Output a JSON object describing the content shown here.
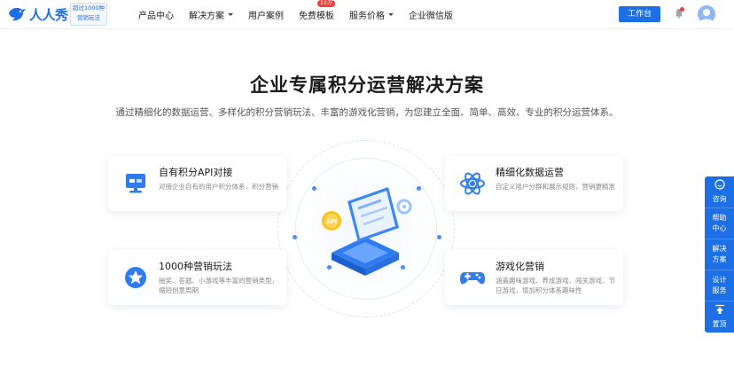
{
  "header": {
    "logo_text": "人人秀",
    "badge_line1": "超过1000种",
    "badge_line2": "营销玩法",
    "nav": [
      {
        "label": "产品中心",
        "dropdown": false
      },
      {
        "label": "解决方案",
        "dropdown": true
      },
      {
        "label": "用户案例",
        "dropdown": false
      },
      {
        "label": "免费模板",
        "dropdown": false,
        "badge": "10万"
      },
      {
        "label": "服务价格",
        "dropdown": true
      },
      {
        "label": "企业微信版",
        "dropdown": false
      }
    ],
    "workbench_label": "工作台",
    "icons": {
      "bell": "bell-icon",
      "avatar": "avatar-icon"
    }
  },
  "hero": {
    "title": "企业专属积分运营解决方案",
    "subtitle": "通过精细化的数据运营、多样化的积分营销玩法、丰富的游戏化营销，为您建立全面、简单、高效、专业的积分运营体系。"
  },
  "cards": [
    {
      "title": "自有积分API对接",
      "desc": "对接企业自有的用户积分体系，积分营销",
      "icon": "api-connect-icon"
    },
    {
      "title": "精细化数据运营",
      "desc": "自定义用户分群和展示规则，营销更精准",
      "icon": "atom-icon"
    },
    {
      "title": "1000种营销玩法",
      "desc": "抽奖、答题、小游戏等丰富的营销类型，缩短创意周期",
      "icon": "star-badge-icon"
    },
    {
      "title": "游戏化营销",
      "desc": "涵盖趣味游戏、养成游戏、闯关游戏、节日游戏，增加积分体系趣味性",
      "icon": "gamepad-icon"
    }
  ],
  "illustration": {
    "api_label": "API"
  },
  "sidebar": [
    {
      "label": "咨询",
      "icon": "chat-icon"
    },
    {
      "label": "帮助中心"
    },
    {
      "label": "解决方案"
    },
    {
      "label": "设计服务"
    },
    {
      "label": "置顶",
      "icon": "arrow-up-icon"
    }
  ],
  "colors": {
    "brand": "#1d6fe6",
    "alert": "#f23d3d",
    "title": "#1a1a1a",
    "muted": "#888888"
  }
}
